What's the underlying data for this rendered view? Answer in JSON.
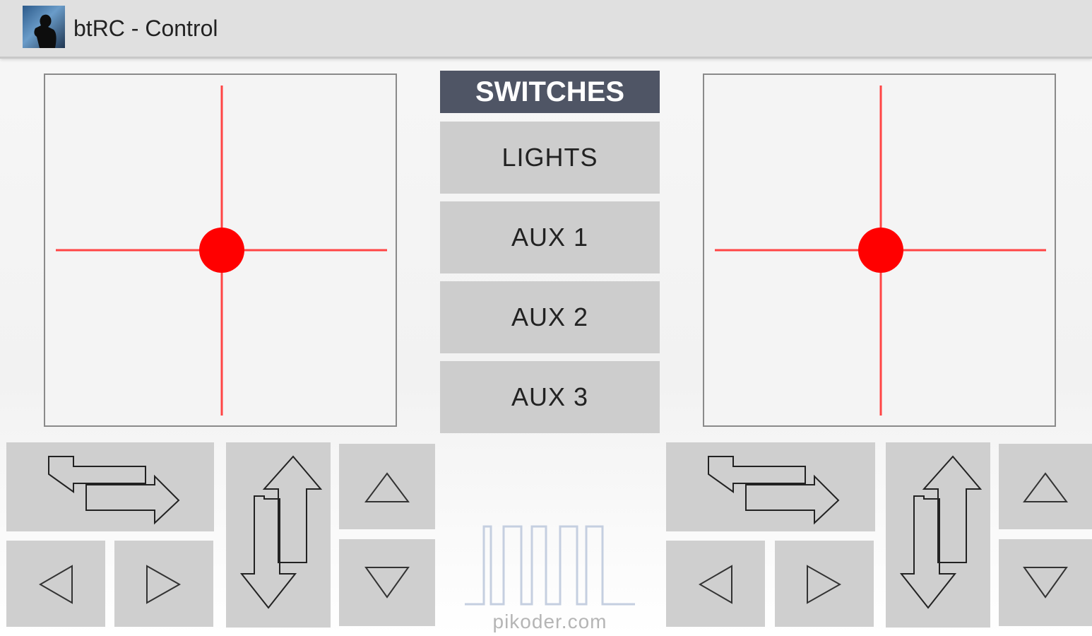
{
  "app": {
    "title": "btRC - Control"
  },
  "switches": {
    "header": "SWITCHES",
    "buttons": [
      "LIGHTS",
      "AUX 1",
      "AUX 2",
      "AUX 3"
    ]
  },
  "footer": {
    "logo_text": "pikoder.com"
  },
  "colors": {
    "crosshair": "#ff4444",
    "knob": "#ff0000",
    "header_bg": "#4f5565",
    "button_bg": "#cdcdcd",
    "control_bg": "#cfcfcf"
  },
  "icons": {
    "app": "app-icon",
    "horizontal": "left-right-arrows-icon",
    "vertical": "up-down-arrows-icon",
    "up": "triangle-up-icon",
    "down": "triangle-down-icon",
    "left": "triangle-left-icon",
    "right": "triangle-right-icon"
  }
}
